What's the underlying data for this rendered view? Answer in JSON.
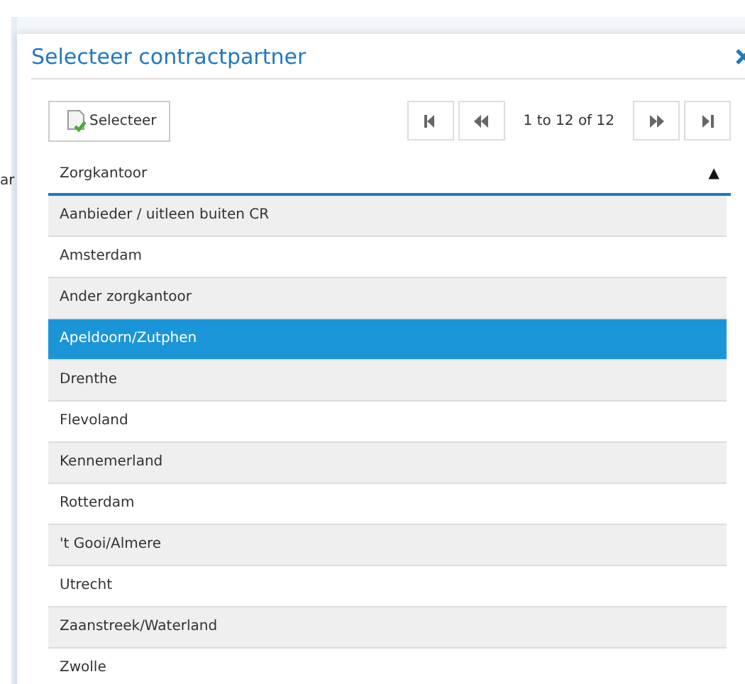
{
  "background": {
    "text_fragment": "ar"
  },
  "dialog": {
    "title": "Selecteer contractpartner"
  },
  "toolbar": {
    "select_button": "Selecteer",
    "paging": {
      "range": "1 to 12 of 12"
    }
  },
  "table": {
    "columns": [
      {
        "label": "Zorgkantoor",
        "sort_icon": "▲"
      }
    ],
    "rows": [
      {
        "name": "Aanbieder / uitleen buiten CR",
        "selected": false
      },
      {
        "name": "Amsterdam",
        "selected": false
      },
      {
        "name": "Ander zorgkantoor",
        "selected": false
      },
      {
        "name": "Apeldoorn/Zutphen",
        "selected": true
      },
      {
        "name": "Drenthe",
        "selected": false
      },
      {
        "name": "Flevoland",
        "selected": false
      },
      {
        "name": "Kennemerland",
        "selected": false
      },
      {
        "name": "Rotterdam",
        "selected": false
      },
      {
        "name": "'t Gooi/Almere",
        "selected": false
      },
      {
        "name": "Utrecht",
        "selected": false
      },
      {
        "name": "Zaanstreek/Waterland",
        "selected": false
      },
      {
        "name": "Zwolle",
        "selected": false
      }
    ]
  }
}
